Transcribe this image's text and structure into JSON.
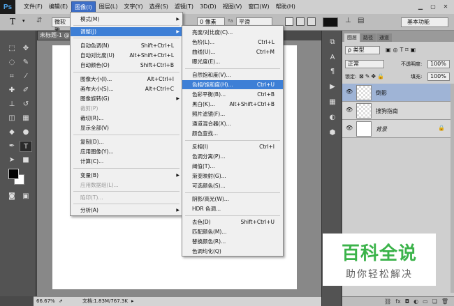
{
  "app": {
    "logo": "Ps"
  },
  "menubar": {
    "items": [
      "文件(F)",
      "编辑(E)",
      "图像(I)",
      "图层(L)",
      "文字(Y)",
      "选择(S)",
      "滤镜(T)",
      "3D(D)",
      "视图(V)",
      "窗口(W)",
      "帮助(H)"
    ],
    "active": "图像(I)"
  },
  "options_bar": {
    "tool_glyph": "T",
    "font_family": "微软雅",
    "font_size": "0 像素",
    "antialias": "平滑",
    "workspace": "基本功能"
  },
  "document": {
    "tab_title": "未标题-1 @",
    "zoom": "66.67%",
    "doc_info": "文档:1.83M/767.3K"
  },
  "image_menu": {
    "items": [
      {
        "label": "模式(M)",
        "submenu": true
      },
      {
        "label": "调整(J)",
        "submenu": true,
        "highlight": true
      },
      {
        "label": "自动色调(N)",
        "shortcut": "Shift+Ctrl+L"
      },
      {
        "label": "自动对比度(U)",
        "shortcut": "Alt+Shift+Ctrl+L"
      },
      {
        "label": "自动颜色(O)",
        "shortcut": "Shift+Ctrl+B"
      },
      {
        "label": "图像大小(I)...",
        "shortcut": "Alt+Ctrl+I"
      },
      {
        "label": "画布大小(S)...",
        "shortcut": "Alt+Ctrl+C"
      },
      {
        "label": "图像旋转(G)",
        "submenu": true
      },
      {
        "label": "裁剪(P)",
        "disabled": true
      },
      {
        "label": "裁切(R)..."
      },
      {
        "label": "显示全部(V)"
      },
      {
        "label": "复制(D)..."
      },
      {
        "label": "应用图像(Y)..."
      },
      {
        "label": "计算(C)..."
      },
      {
        "label": "变量(B)",
        "submenu": true
      },
      {
        "label": "应用数据组(L)...",
        "disabled": true
      },
      {
        "label": "陷印(T)...",
        "disabled": true
      },
      {
        "label": "分析(A)",
        "submenu": true
      }
    ]
  },
  "adjust_menu": {
    "items": [
      {
        "label": "亮度/对比度(C)..."
      },
      {
        "label": "色阶(L)...",
        "shortcut": "Ctrl+L"
      },
      {
        "label": "曲线(U)...",
        "shortcut": "Ctrl+M"
      },
      {
        "label": "曝光度(E)..."
      },
      {
        "label": "自然饱和度(V)..."
      },
      {
        "label": "色相/饱和度(H)...",
        "shortcut": "Ctrl+U",
        "highlight": true
      },
      {
        "label": "色彩平衡(B)...",
        "shortcut": "Ctrl+B"
      },
      {
        "label": "黑白(K)...",
        "shortcut": "Alt+Shift+Ctrl+B"
      },
      {
        "label": "照片滤镜(F)..."
      },
      {
        "label": "通道混合器(X)..."
      },
      {
        "label": "颜色查找..."
      },
      {
        "label": "反相(I)",
        "shortcut": "Ctrl+I"
      },
      {
        "label": "色调分离(P)..."
      },
      {
        "label": "阈值(T)..."
      },
      {
        "label": "渐变映射(G)..."
      },
      {
        "label": "可选颜色(S)..."
      },
      {
        "label": "阴影/高光(W)..."
      },
      {
        "label": "HDR 色调..."
      },
      {
        "label": "去色(D)",
        "shortcut": "Shift+Ctrl+U"
      },
      {
        "label": "匹配颜色(M)..."
      },
      {
        "label": "替换颜色(R)..."
      },
      {
        "label": "色调均化(Q)"
      }
    ]
  },
  "layers_panel": {
    "tabs": [
      "图层",
      "路径",
      "通道"
    ],
    "filter": "ρ 类型",
    "blend_mode": "正常",
    "opacity_label": "不透明度:",
    "opacity": "100%",
    "lock_label": "锁定:",
    "fill_label": "填充:",
    "fill": "100%",
    "layers": [
      {
        "name": "倒影",
        "selected": true
      },
      {
        "name": "搜狗指南"
      },
      {
        "name": "背景",
        "locked": true
      }
    ]
  },
  "watermark": {
    "title": "百科全说",
    "subtitle": "助你轻松解决"
  }
}
